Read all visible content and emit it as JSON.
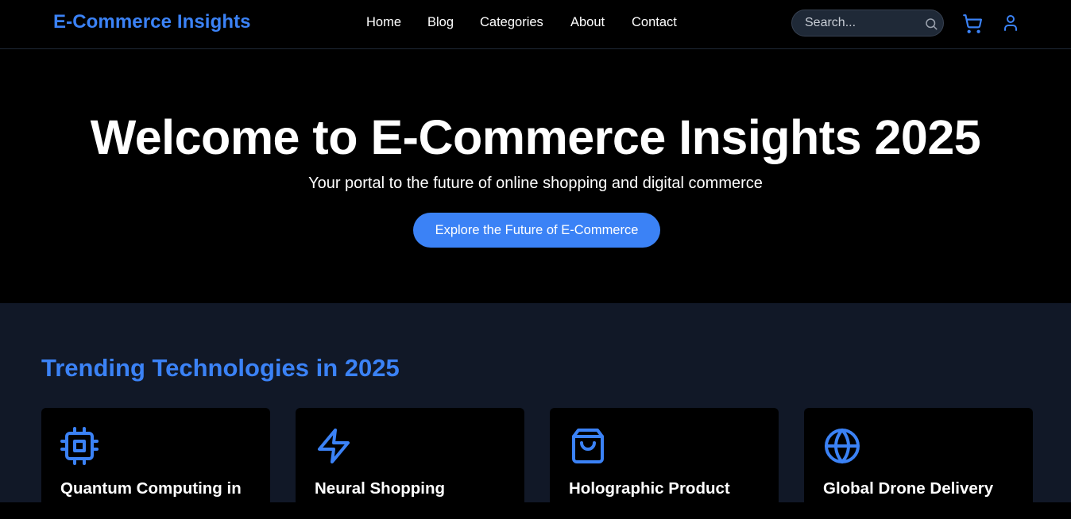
{
  "header": {
    "brand": "E-Commerce Insights",
    "nav": [
      "Home",
      "Blog",
      "Categories",
      "About",
      "Contact"
    ],
    "search_placeholder": "Search...",
    "icons": [
      "search-icon",
      "cart-icon",
      "user-icon"
    ]
  },
  "hero": {
    "title": "Welcome to E-Commerce Insights 2025",
    "subtitle": "Your portal to the future of online shopping and digital commerce",
    "cta_label": "Explore the Future of E-Commerce"
  },
  "trending": {
    "title": "Trending Technologies in 2025",
    "cards": [
      {
        "icon": "cpu-icon",
        "title": "Quantum Computing in"
      },
      {
        "icon": "lightning-icon",
        "title": "Neural Shopping"
      },
      {
        "icon": "shopping-bag-icon",
        "title": "Holographic Product"
      },
      {
        "icon": "globe-icon",
        "title": "Global Drone Delivery"
      }
    ]
  },
  "colors": {
    "accent": "#3b82f6",
    "background": "#000000",
    "section_background": "#111827",
    "search_background": "#1f2937"
  }
}
